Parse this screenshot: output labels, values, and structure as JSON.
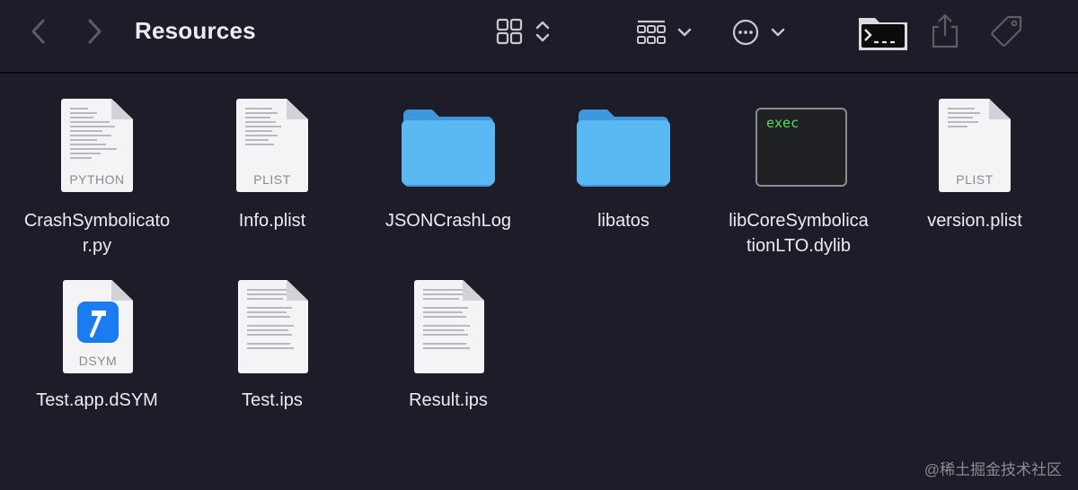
{
  "window": {
    "title": "Resources"
  },
  "toolbar": {
    "back_icon": "chevron-left-icon",
    "forward_icon": "chevron-right-icon",
    "view_icon": "grid-view-icon",
    "group_icon": "group-by-icon",
    "more_icon": "ellipsis-circle-icon",
    "terminal_icon": "terminal-folder-icon",
    "share_icon": "share-icon",
    "tag_icon": "tag-icon"
  },
  "files": [
    {
      "name": "CrashSymbolicator.py",
      "line1": "CrashSymbolicato",
      "line2": "r.py",
      "kind": "document",
      "badge": "PYTHON"
    },
    {
      "name": "Info.plist",
      "line1": "Info.plist",
      "line2": "",
      "kind": "document",
      "badge": "PLIST"
    },
    {
      "name": "JSONCrashLog",
      "line1": "JSONCrashLog",
      "line2": "",
      "kind": "folder",
      "color": "#5ab8f2"
    },
    {
      "name": "libatos",
      "line1": "libatos",
      "line2": "",
      "kind": "folder",
      "color": "#5ab8f2"
    },
    {
      "name": "libCoreSymbolicationLTO.dylib",
      "line1": "libCoreSymbolica",
      "line2": "tionLTO.dylib",
      "kind": "exec",
      "badge": "exec"
    },
    {
      "name": "version.plist",
      "line1": "version.plist",
      "line2": "",
      "kind": "document",
      "badge": "PLIST"
    },
    {
      "name": "Test.app.dSYM",
      "line1": "Test.app.dSYM",
      "line2": "",
      "kind": "dsym",
      "badge": "DSYM"
    },
    {
      "name": "Test.ips",
      "line1": "Test.ips",
      "line2": "",
      "kind": "text"
    },
    {
      "name": "Result.ips",
      "line1": "Result.ips",
      "line2": "",
      "kind": "text"
    }
  ],
  "watermark": "@稀土掘金技术社区",
  "colors": {
    "background": "#1e1c28",
    "folder": "#5ab8f2",
    "exec_text": "#4fe05a",
    "dsym_blue": "#1a7cf0"
  }
}
